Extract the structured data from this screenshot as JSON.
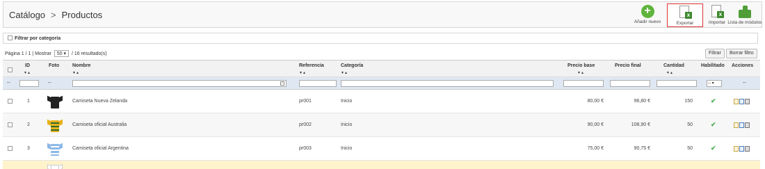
{
  "breadcrumb": {
    "parent": "Catálogo",
    "separator": ">",
    "current": "Productos"
  },
  "toolbar": {
    "add_label": "Añadir nuevo",
    "export_label": "Exportar",
    "import_label": "Importar",
    "modules_label": "Lista de módulos",
    "accent": "#5fb43b"
  },
  "category_filter": {
    "label": "Filtrar por categoría"
  },
  "pagination": {
    "page_text": "Página 1 / 1 | Mostrar",
    "per_page": "50",
    "results_text": "/ 16 resultado(s)"
  },
  "actions": {
    "filter_label": "Filtrar",
    "reset_label": "Borrar filtro"
  },
  "columns": {
    "id": "ID",
    "photo": "Foto",
    "name": "Nombre",
    "reference": "Referencia",
    "category": "Categoría",
    "base_price": "Precio base",
    "final_price": "Precio final",
    "quantity": "Cantidad",
    "enabled": "Habilitado",
    "actions": "Acciones"
  },
  "filters": {
    "dash": "--",
    "enabled_select": "--"
  },
  "products": [
    {
      "id": "1",
      "name": "Camiseta Nueva Zelanda",
      "reference": "pr001",
      "category": "Inicio",
      "base_price": "80,00 €",
      "final_price": "96,80 €",
      "quantity": "150",
      "enabled": "✔",
      "shirt_color": "#222222",
      "shirt_accent": "#222222"
    },
    {
      "id": "2",
      "name": "Camiseta oficial Australia",
      "reference": "pr002",
      "category": "Inicio",
      "base_price": "90,00 €",
      "final_price": "108,90 €",
      "quantity": "50",
      "enabled": "✔",
      "shirt_color": "#e6b21c",
      "shirt_accent": "#2e6b2e"
    },
    {
      "id": "3",
      "name": "Camiseta oficial Argentina",
      "reference": "pr003",
      "category": "Inicio",
      "base_price": "75,00 €",
      "final_price": "90,75 €",
      "quantity": "50",
      "enabled": "✔",
      "shirt_color": "#8db8e8",
      "shirt_accent": "#ffffff"
    }
  ]
}
